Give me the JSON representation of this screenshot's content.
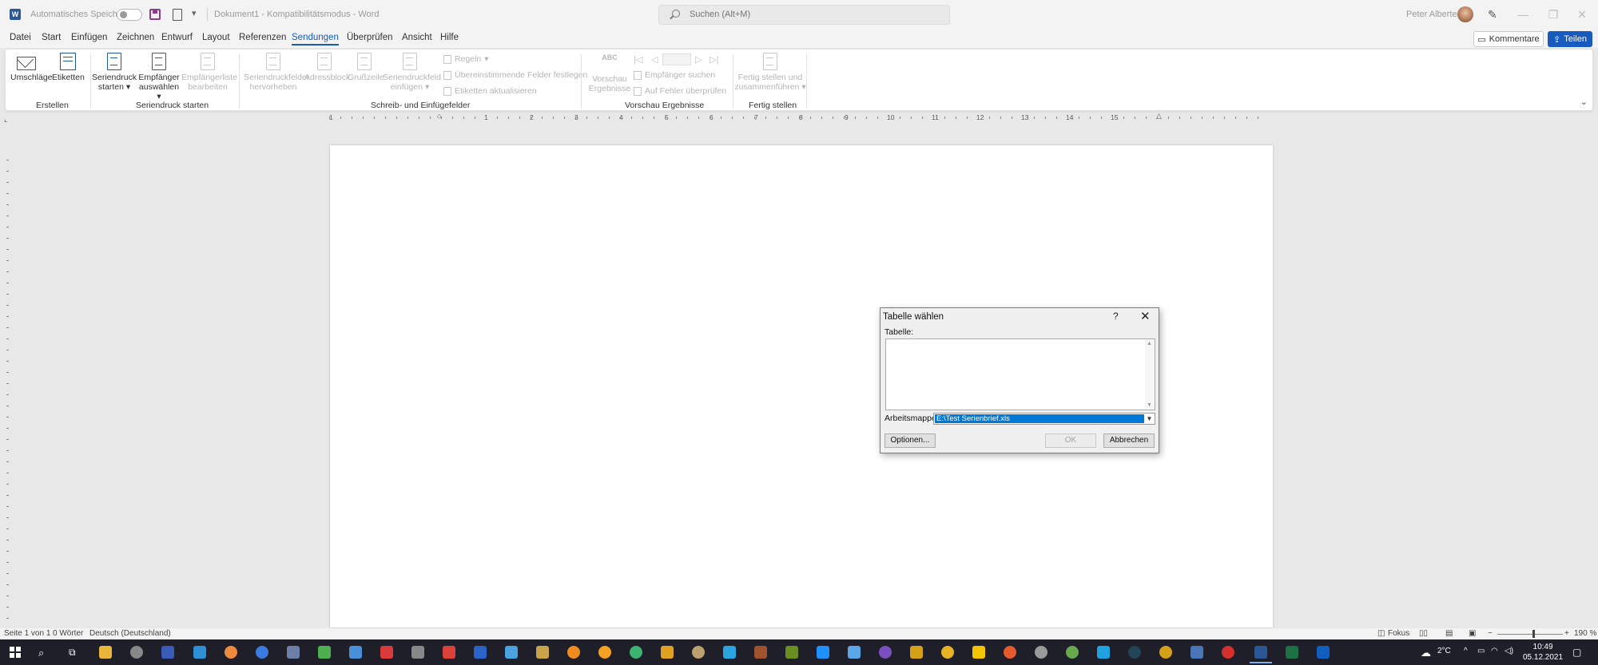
{
  "titlebar": {
    "autosave_label": "Automatisches Speichern",
    "doc_title": "Dokument1  -  Kompatibilitätsmodus  -  Word",
    "search_placeholder": "Suchen (Alt+M)",
    "user_name": "Peter Alberter",
    "minimize": "—",
    "restore": "❐",
    "close": "✕"
  },
  "tabs": [
    "Datei",
    "Start",
    "Einfügen",
    "Zeichnen",
    "Entwurf",
    "Layout",
    "Referenzen",
    "Sendungen",
    "Überprüfen",
    "Ansicht",
    "Hilfe"
  ],
  "active_tab": "Sendungen",
  "header_buttons": {
    "comments": "Kommentare",
    "share": "Teilen"
  },
  "ribbon": {
    "envelopes": "Umschläge",
    "labels": "Etiketten",
    "start_merge_1": "Seriendruck",
    "start_merge_2": "starten",
    "select_recipients_1": "Empfänger",
    "select_recipients_2": "auswählen",
    "edit_list_1": "Empfängerliste",
    "edit_list_2": "bearbeiten",
    "highlight_1": "Seriendruckfelder",
    "highlight_2": "hervorheben",
    "address_block": "Adressblock",
    "greeting": "Grußzeile",
    "insert_field_1": "Seriendruckfeld",
    "insert_field_2": "einfügen",
    "rules": "Regeln",
    "match_fields": "Übereinstimmende Felder festlegen",
    "update_labels": "Etiketten aktualisieren",
    "preview_1": "Vorschau",
    "preview_2": "Ergebnisse",
    "abc": "ABC",
    "find_recipient": "Empfänger suchen",
    "check_errors": "Auf Fehler überprüfen",
    "finish_1": "Fertig stellen und",
    "finish_2": "zusammenführen",
    "group_create": "Erstellen",
    "group_start": "Seriendruck starten",
    "group_fields": "Schreib- und Einfügefelder",
    "group_preview": "Vorschau Ergebnisse",
    "group_finish": "Fertig stellen"
  },
  "ruler": [
    "1",
    "1",
    "2",
    "3",
    "4",
    "5",
    "6",
    "7",
    "8",
    "9",
    "10",
    "11",
    "12",
    "13",
    "14",
    "15"
  ],
  "dialog": {
    "title": "Tabelle wählen",
    "help": "?",
    "close": "✕",
    "table_label": "Tabelle:",
    "workbook_label": "Arbeitsmappe:",
    "workbook_value": "E:\\Test Serienbrief.xls",
    "options": "Optionen...",
    "ok": "OK",
    "cancel": "Abbrechen"
  },
  "status": {
    "page": "Seite 1 von 1",
    "words": "0 Wörter",
    "language": "Deutsch (Deutschland)",
    "focus": "Fokus",
    "zoom": "190 %"
  },
  "taskbar": {
    "temp": "2°C",
    "time": "10:49",
    "date": "05.12.2021"
  },
  "colors": {
    "accent": "#185abd",
    "selection": "#0078d7",
    "taskbar": "#1f1f2a"
  }
}
